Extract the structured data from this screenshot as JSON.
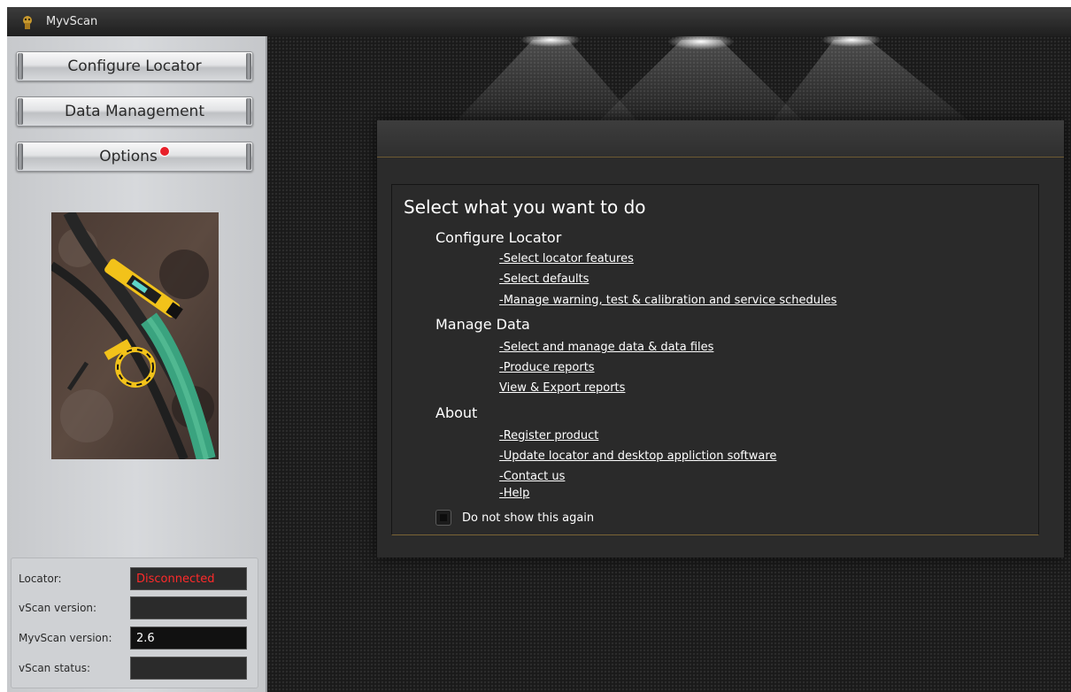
{
  "window": {
    "title": "MyvScan"
  },
  "sidebar": {
    "buttons": [
      {
        "label": "Configure Locator"
      },
      {
        "label": "Data Management"
      },
      {
        "label": "Options"
      }
    ],
    "status": {
      "locator_label": "Locator:",
      "locator_value": "Disconnected",
      "vscan_version_label": "vScan version:",
      "vscan_version_value": "",
      "myvscan_version_label": "MyvScan version:",
      "myvscan_version_value": "2.6",
      "vscan_status_label": "vScan status:",
      "vscan_status_value": ""
    }
  },
  "dialog": {
    "heading": "Select what you want to do",
    "sections": [
      {
        "title": "Configure Locator",
        "links": [
          "-Select locator features",
          "-Select defaults",
          "-Manage warning, test & calibration and service schedules"
        ]
      },
      {
        "title": "Manage Data",
        "links": [
          "-Select and manage data & data files",
          "-Produce reports",
          "View & Export reports"
        ]
      },
      {
        "title": "About",
        "links": [
          "-Register product",
          "-Update locator and desktop appliction software",
          "-Contact us",
          "-Help"
        ]
      }
    ],
    "checkbox_label": "Do not show this again"
  },
  "colors": {
    "disconnected": "#ff2a2a",
    "notification_dot": "#e8202a",
    "accent_line": "#7b6535"
  }
}
